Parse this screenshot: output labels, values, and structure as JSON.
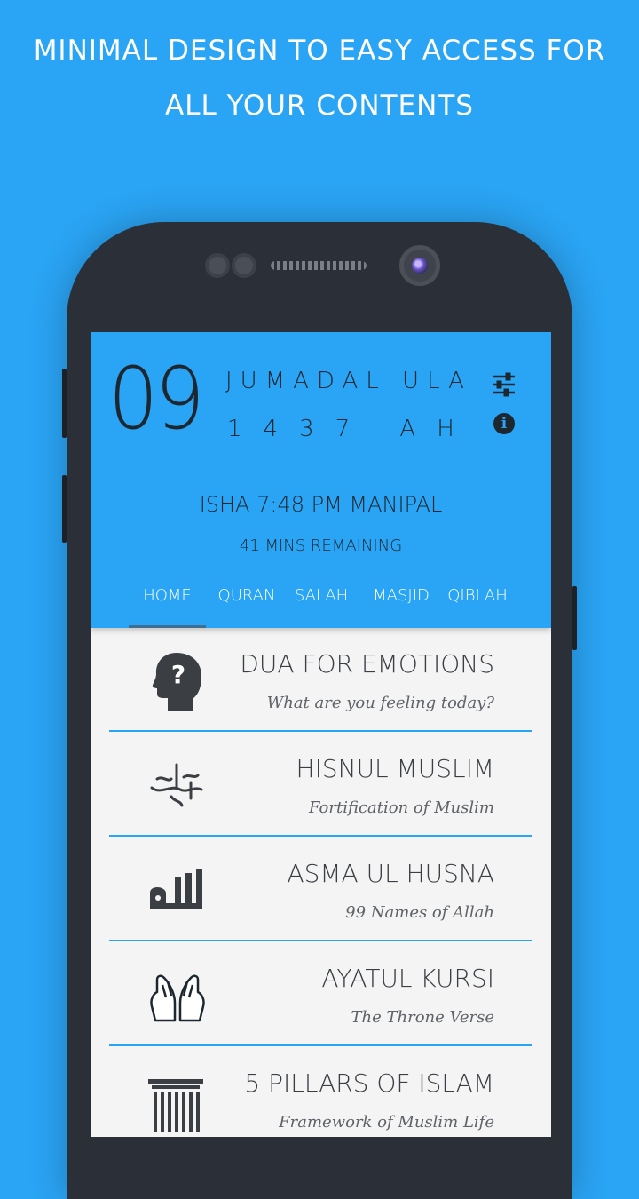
{
  "promo": {
    "line1": "MINIMAL DESIGN TO EASY ACCESS FOR",
    "line2": "ALL YOUR CONTENTS"
  },
  "header": {
    "day": "09",
    "month": "JUMADAL ULA",
    "year": "1437 AH",
    "prayer": "ISHA 7:48 PM MANIPAL",
    "remaining": "41 MINS REMAINING",
    "settings_icon": "sliders-icon",
    "info_icon": "info-icon"
  },
  "tabs": [
    {
      "label": "HOME",
      "active": true
    },
    {
      "label": "QURAN",
      "active": false
    },
    {
      "label": "SALAH",
      "active": false
    },
    {
      "label": "MASJID",
      "active": false
    },
    {
      "label": "QIBLAH",
      "active": false
    }
  ],
  "items": [
    {
      "title": "DUA FOR EMOTIONS",
      "subtitle": "What are you feeling today?",
      "icon": "head-question-icon"
    },
    {
      "title": "HISNUL MUSLIM",
      "subtitle": "Fortification of Muslim",
      "icon": "calligraphy-icon"
    },
    {
      "title": "ASMA UL HUSNA",
      "subtitle": "99 Names of Allah",
      "icon": "allah-calligraphy-icon"
    },
    {
      "title": "AYATUL KURSI",
      "subtitle": "The Throne Verse",
      "icon": "praying-hands-icon"
    },
    {
      "title": "5 PILLARS OF ISLAM",
      "subtitle": "Framework of Muslim Life",
      "icon": "pillar-icon"
    }
  ],
  "colors": {
    "background": "#2aa4f4",
    "accent": "#2aa4f4",
    "text_dark": "#1d2730"
  }
}
